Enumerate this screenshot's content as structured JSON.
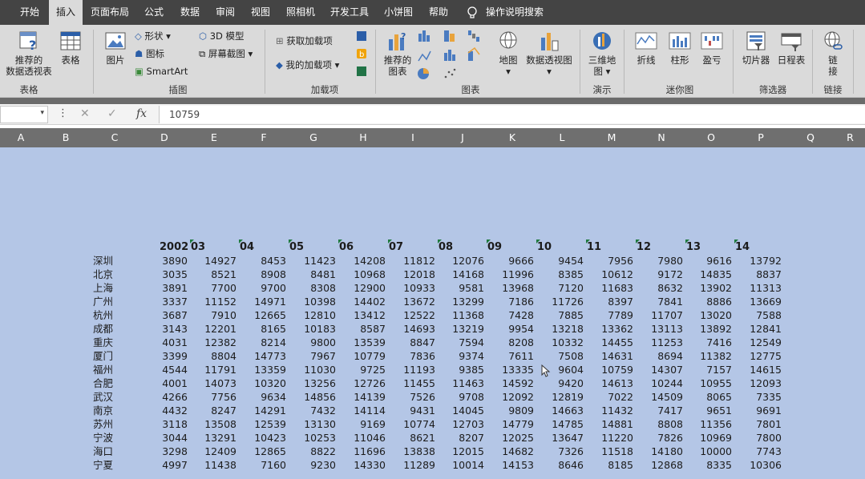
{
  "ribbon_tabs": [
    "开始",
    "插入",
    "页面布局",
    "公式",
    "数据",
    "审阅",
    "视图",
    "照相机",
    "开发工具",
    "小饼图",
    "帮助"
  ],
  "active_tab": "插入",
  "tell_me": "操作说明搜索",
  "ribbon": {
    "pivot_recommended": [
      "推荐的",
      "数据透视表"
    ],
    "table": "表格",
    "group_tables": "表格",
    "picture": "图片",
    "shapes": "形状",
    "icons": "图标",
    "smartart": "SmartArt",
    "model3d": "3D 模型",
    "screenshot": "屏幕截图",
    "group_illustrations": "插图",
    "get_addins": "获取加载项",
    "my_addins": "我的加载项",
    "group_addins": "加载项",
    "recommended_charts": [
      "推荐的",
      "图表"
    ],
    "map": "地图",
    "pivot_chart": "数据透视图",
    "group_charts": "图表",
    "map3d": [
      "三维地",
      "图"
    ],
    "group_tours": "演示",
    "spark_line": "折线",
    "spark_column": "柱形",
    "spark_winloss": "盈亏",
    "group_sparklines": "迷你图",
    "slicer": "切片器",
    "timeline": "日程表",
    "group_filters": "筛选器",
    "link": [
      "链",
      "接"
    ],
    "group_links": "链接"
  },
  "formula_bar": {
    "value": "10759"
  },
  "column_headers": [
    "A",
    "B",
    "C",
    "D",
    "E",
    "F",
    "G",
    "H",
    "I",
    "J",
    "K",
    "L",
    "M",
    "N",
    "O",
    "P",
    "Q",
    "R"
  ],
  "table": {
    "years": [
      "2002",
      "03",
      "04",
      "05",
      "06",
      "07",
      "08",
      "09",
      "10",
      "11",
      "12",
      "13",
      "14"
    ],
    "rows": [
      {
        "city": "深圳",
        "values": [
          3890,
          14927,
          8453,
          11423,
          14208,
          11812,
          12076,
          9666,
          9454,
          7956,
          7980,
          9616,
          13792
        ]
      },
      {
        "city": "北京",
        "values": [
          3035,
          8521,
          8908,
          8481,
          10968,
          12018,
          14168,
          11996,
          8385,
          10612,
          9172,
          14835,
          8837
        ]
      },
      {
        "city": "上海",
        "values": [
          3891,
          7700,
          9700,
          8308,
          12900,
          10933,
          9581,
          13968,
          7120,
          11683,
          8632,
          13902,
          11313
        ]
      },
      {
        "city": "广州",
        "values": [
          3337,
          11152,
          14971,
          10398,
          14402,
          13672,
          13299,
          7186,
          11726,
          8397,
          7841,
          8886,
          13669
        ]
      },
      {
        "city": "杭州",
        "values": [
          3687,
          7910,
          12665,
          12810,
          13412,
          12522,
          11368,
          7428,
          7885,
          7789,
          11707,
          13020,
          7588
        ]
      },
      {
        "city": "成都",
        "values": [
          3143,
          12201,
          8165,
          10183,
          8587,
          14693,
          13219,
          9954,
          13218,
          13362,
          13113,
          13892,
          12841
        ]
      },
      {
        "city": "重庆",
        "values": [
          4031,
          12382,
          8214,
          9800,
          13539,
          8847,
          7594,
          8208,
          10332,
          14455,
          11253,
          7416,
          12549
        ]
      },
      {
        "city": "厦门",
        "values": [
          3399,
          8804,
          14773,
          7967,
          10779,
          7836,
          9374,
          7611,
          7508,
          14631,
          8694,
          11382,
          12775
        ]
      },
      {
        "city": "福州",
        "values": [
          4544,
          11791,
          13359,
          11030,
          9725,
          11193,
          9385,
          13335,
          9604,
          10759,
          14307,
          7157,
          14615
        ]
      },
      {
        "city": "合肥",
        "values": [
          4001,
          14073,
          10320,
          13256,
          12726,
          11455,
          11463,
          14592,
          9420,
          14613,
          10244,
          10955,
          12093
        ]
      },
      {
        "city": "武汉",
        "values": [
          4266,
          7756,
          9634,
          14856,
          14139,
          7526,
          9708,
          12092,
          12819,
          7022,
          14509,
          8065,
          7335
        ]
      },
      {
        "city": "南京",
        "values": [
          4432,
          8247,
          14291,
          7432,
          14114,
          9431,
          14045,
          9809,
          14663,
          11432,
          7417,
          9651,
          9691
        ]
      },
      {
        "city": "苏州",
        "values": [
          3118,
          13508,
          12539,
          13130,
          9169,
          10774,
          12703,
          14779,
          14785,
          14881,
          8808,
          11356,
          7801
        ]
      },
      {
        "city": "宁波",
        "values": [
          3044,
          13291,
          10423,
          10253,
          11046,
          8621,
          8207,
          12025,
          13647,
          11220,
          7826,
          10969,
          7800
        ]
      },
      {
        "city": "海口",
        "values": [
          3298,
          12409,
          12865,
          8822,
          11696,
          13838,
          12015,
          14682,
          7326,
          11518,
          14180,
          10000,
          7743
        ]
      },
      {
        "city": "宁夏",
        "values": [
          4997,
          11438,
          7160,
          9230,
          14330,
          11289,
          10014,
          14153,
          8646,
          8185,
          12868,
          8335,
          10306
        ]
      }
    ]
  },
  "colors": {
    "sheet_bg": "#b4c6e6",
    "tab_bar": "#444444",
    "ribbon": "#dadada",
    "col_header": "#6f6f6f",
    "error_marker": "#1f7a3f"
  }
}
